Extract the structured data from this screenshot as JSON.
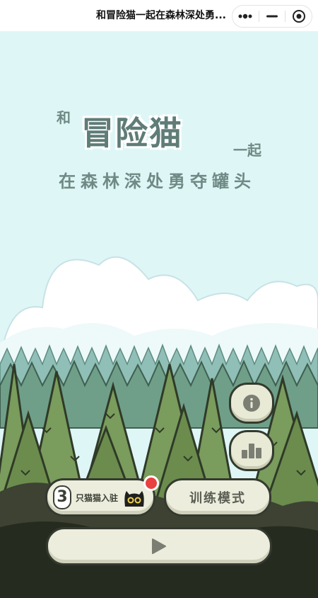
{
  "topbar": {
    "title": "和冒险猫一起在森林深处勇...",
    "more_icon": "more-dots-icon",
    "minimize_icon": "minimize-icon",
    "close_icon": "target-close-icon"
  },
  "game_title": {
    "prefix": "和",
    "main": "冒险猫",
    "suffix": "一起",
    "subtitle": "在森林深处勇夺罐头"
  },
  "buttons": {
    "info_icon": "info-icon",
    "leaderboard_icon": "bar-chart-icon",
    "cats_count": "3",
    "cats_label": "只猫猫入驻",
    "training_label": "训练模式",
    "play_icon": "play-icon"
  },
  "colors": {
    "sky": "#dff6f7",
    "title_text": "#5f7c77",
    "button_fill": "#eceddc",
    "button_border": "#343a30",
    "notification": "#e94040"
  }
}
